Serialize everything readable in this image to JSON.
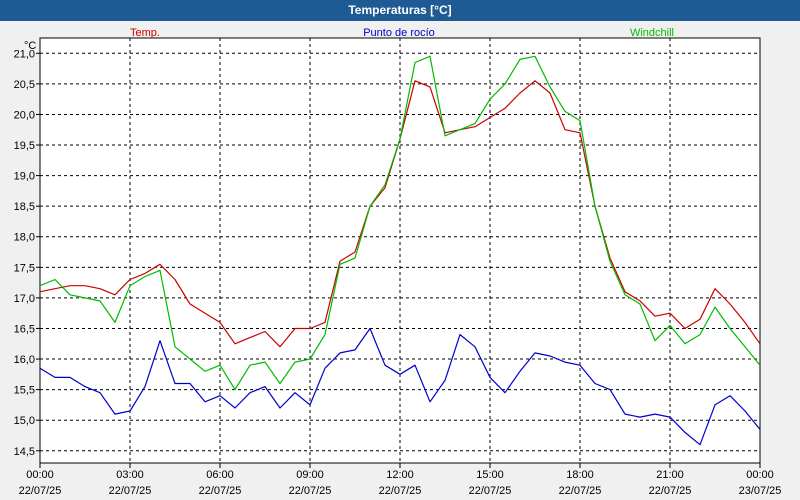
{
  "window": {
    "title": "Temperaturas [°C]"
  },
  "chart_data": {
    "type": "line",
    "title": "Temperaturas [°C]",
    "ylabel": "°C",
    "ylim": [
      14.3,
      21.25
    ],
    "grid": true,
    "legend_position": "top",
    "y_ticks": [
      "14,5",
      "15,0",
      "15,5",
      "16,0",
      "16,5",
      "17,0",
      "17,5",
      "18,0",
      "18,5",
      "19,0",
      "19,5",
      "20,0",
      "20,5",
      "21,0"
    ],
    "y_tick_values": [
      14.5,
      15.0,
      15.5,
      16.0,
      16.5,
      17.0,
      17.5,
      18.0,
      18.5,
      19.0,
      19.5,
      20.0,
      20.5,
      21.0
    ],
    "x_ticks": [
      {
        "time": "00:00",
        "date": "22/07/25"
      },
      {
        "time": "03:00",
        "date": "22/07/25"
      },
      {
        "time": "06:00",
        "date": "22/07/25"
      },
      {
        "time": "09:00",
        "date": "22/07/25"
      },
      {
        "time": "12:00",
        "date": "22/07/25"
      },
      {
        "time": "15:00",
        "date": "22/07/25"
      },
      {
        "time": "18:00",
        "date": "22/07/25"
      },
      {
        "time": "21:00",
        "date": "22/07/25"
      },
      {
        "time": "00:00",
        "date": "23/07/25"
      }
    ],
    "x_hours": [
      0,
      0.5,
      1,
      1.5,
      2,
      2.5,
      3,
      3.5,
      4,
      4.5,
      5,
      5.5,
      6,
      6.5,
      7,
      7.5,
      8,
      8.5,
      9,
      9.5,
      10,
      10.5,
      11,
      11.5,
      12,
      12.5,
      13,
      13.5,
      14,
      14.5,
      15,
      15.5,
      16,
      16.5,
      17,
      17.5,
      18,
      18.5,
      19,
      19.5,
      20,
      20.5,
      21,
      21.5,
      22,
      22.5,
      23,
      23.5,
      24
    ],
    "series": [
      {
        "name": "Temp.",
        "color": "#cc0000",
        "values": [
          17.1,
          17.15,
          17.2,
          17.2,
          17.15,
          17.05,
          17.3,
          17.4,
          17.55,
          17.3,
          16.9,
          16.75,
          16.6,
          16.25,
          16.35,
          16.45,
          16.2,
          16.5,
          16.5,
          16.6,
          17.6,
          17.75,
          18.5,
          18.8,
          19.6,
          20.55,
          20.45,
          19.7,
          19.75,
          19.8,
          19.95,
          20.1,
          20.35,
          20.55,
          20.35,
          19.75,
          19.7,
          18.5,
          17.65,
          17.1,
          16.95,
          16.7,
          16.75,
          16.5,
          16.65,
          17.15,
          16.9,
          16.6,
          16.25
        ]
      },
      {
        "name": "Punto de rocío",
        "color": "#0000cc",
        "values": [
          15.85,
          15.7,
          15.7,
          15.55,
          15.45,
          15.1,
          15.15,
          15.55,
          16.3,
          15.6,
          15.6,
          15.3,
          15.4,
          15.2,
          15.45,
          15.55,
          15.2,
          15.45,
          15.25,
          15.85,
          16.1,
          16.15,
          16.5,
          15.9,
          15.75,
          15.9,
          15.3,
          15.65,
          16.4,
          16.2,
          15.7,
          15.45,
          15.8,
          16.1,
          16.05,
          15.95,
          15.9,
          15.6,
          15.5,
          15.1,
          15.05,
          15.1,
          15.05,
          14.8,
          14.6,
          15.25,
          15.4,
          15.15,
          14.85
        ]
      },
      {
        "name": "Windchill",
        "color": "#00bb00",
        "values": [
          17.2,
          17.3,
          17.05,
          17.0,
          16.95,
          16.6,
          17.2,
          17.35,
          17.45,
          16.2,
          16.0,
          15.8,
          15.9,
          15.5,
          15.9,
          15.95,
          15.6,
          15.95,
          16.0,
          16.4,
          17.55,
          17.65,
          18.5,
          18.85,
          19.6,
          20.85,
          20.95,
          19.65,
          19.75,
          19.85,
          20.25,
          20.5,
          20.9,
          20.95,
          20.45,
          20.05,
          19.9,
          18.5,
          17.6,
          17.05,
          16.9,
          16.3,
          16.55,
          16.25,
          16.4,
          16.85,
          16.5,
          16.2,
          15.9
        ]
      }
    ]
  }
}
